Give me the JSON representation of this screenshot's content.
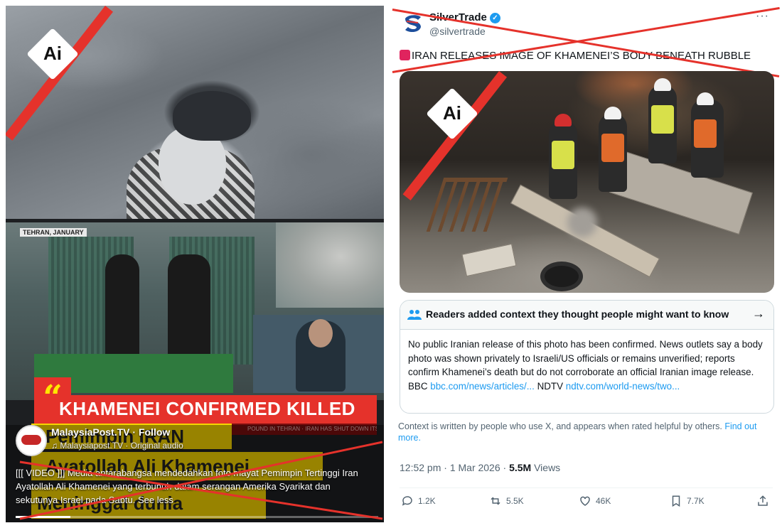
{
  "left_panel": {
    "ai_badge_text": "Ai",
    "tehran_tag": "TEHRAN, JANUARY",
    "quote_mark": "“",
    "headline": "KHAMENEI CONFIRMED KILLED",
    "ticker_text": "POUND IN TEHRAN  ·  IRAN HAS SHUT DOWN ITS",
    "yellow_line_1": "Pemimpin IRAN",
    "yellow_line_2": "Ayatollah Ali Khamenei",
    "yellow_line_3": "Meninggal dunia",
    "reel": {
      "account": "MalaysiaPost.TV",
      "follow_label": "Follow",
      "audio": "♫ Malaysiapost.TV · Original audio",
      "caption": "[[[ VIDEO ]]] Media antarabangsa mendedahkan foto mayat Pemimpin Tertinggi Iran Ayatollah Ali Khamenei yang terbunuh dalam serangan Amerika Syarikat dan sekutunya Israel pada Sabtu. See less",
      "progress": 0.15
    }
  },
  "tweet": {
    "account_name": "SilverTrade",
    "handle": "@silvertrade",
    "more_label": "···",
    "text": "IRAN RELEASES IMAGE OF KHAMENEI’S BODY BENEATH RUBBLE",
    "ai_badge_text": "Ai",
    "note": {
      "title": "Readers added context they thought people might want to know",
      "body": "No public Iranian release of this photo has been confirmed. News outlets say a body photo was shown privately to Israeli/US officials or remains unverified; reports confirm Khamenei’s death but do not corroborate an official Iranian image release. BBC ",
      "link1": "bbc.com/news/articles/...",
      "mid": " NDTV ",
      "link2": "ndtv.com/world-news/two..."
    },
    "context_text": "Context is written by people who use X, and appears when rated helpful by others. ",
    "context_link": "Find out more.",
    "time": "12:52 pm · 1 Mar 2026 · ",
    "views_count": "5.5M",
    "views_label": " Views",
    "replies": "1.2K",
    "reposts": "5.5K",
    "likes": "46K",
    "bookmarks": "7.7K"
  },
  "colors": {
    "slash_red": "#e5322b",
    "verified_blue": "#1d9bf0",
    "link_blue": "#1d9bf0",
    "headline_red": "#e5322b",
    "banner_yellow": "#f6d400"
  },
  "icons": [
    "ai-badge",
    "verified-badge",
    "more-icon",
    "siren-icon",
    "people-icon",
    "arrow-right-icon",
    "reply-icon",
    "repost-icon",
    "like-icon",
    "bookmark-icon",
    "share-icon"
  ]
}
